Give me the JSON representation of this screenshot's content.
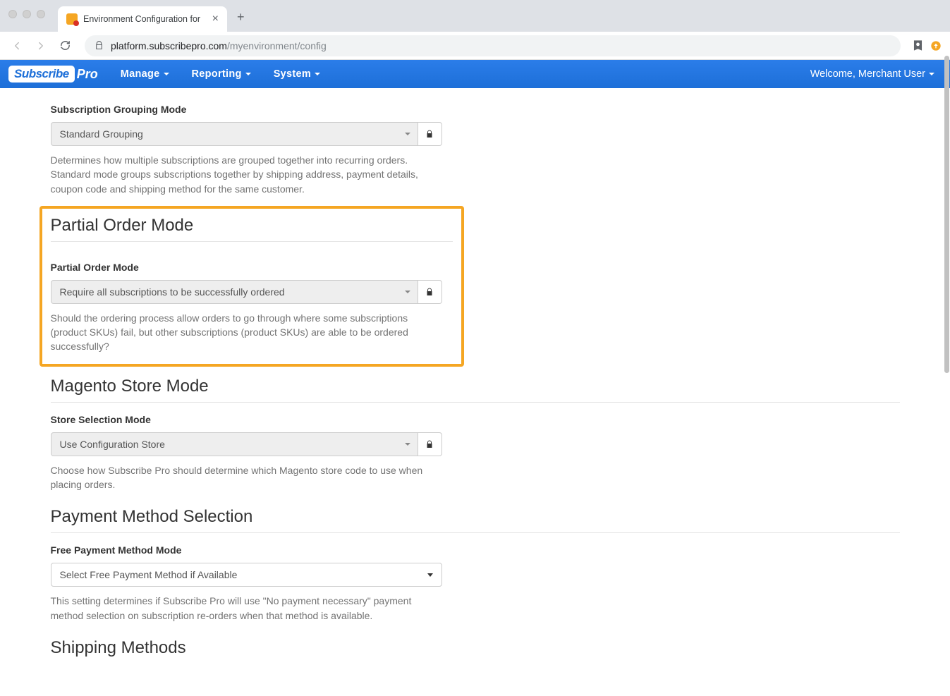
{
  "browser": {
    "tab_title": "Environment Configuration for",
    "url_host": "platform.subscribepro.com",
    "url_path": "/myenvironment/config"
  },
  "navbar": {
    "logo_main": "Subscribe",
    "logo_suffix": "Pro",
    "menu": [
      "Manage",
      "Reporting",
      "System"
    ],
    "welcome": "Welcome, Merchant User"
  },
  "sections": {
    "grouping": {
      "label": "Subscription Grouping Mode",
      "value": "Standard Grouping",
      "help": "Determines how multiple subscriptions are grouped together into recurring orders. Standard mode groups subscriptions together by shipping address, payment details, coupon code and shipping method for the same customer."
    },
    "partial": {
      "title": "Partial Order Mode",
      "label": "Partial Order Mode",
      "value": "Require all subscriptions to be successfully ordered",
      "help": "Should the ordering process allow orders to go through where some subscriptions (product SKUs) fail, but other subscriptions (product SKUs) are able to be ordered successfully?"
    },
    "magento": {
      "title": "Magento Store Mode",
      "label": "Store Selection Mode",
      "value": "Use Configuration Store",
      "help": "Choose how Subscribe Pro should determine which Magento store code to use when placing orders."
    },
    "payment": {
      "title": "Payment Method Selection",
      "label": "Free Payment Method Mode",
      "value": "Select Free Payment Method if Available",
      "help": "This setting determines if Subscribe Pro will use \"No payment necessary\" payment method selection on subscription re-orders when that method is available."
    },
    "shipping": {
      "title": "Shipping Methods"
    }
  }
}
